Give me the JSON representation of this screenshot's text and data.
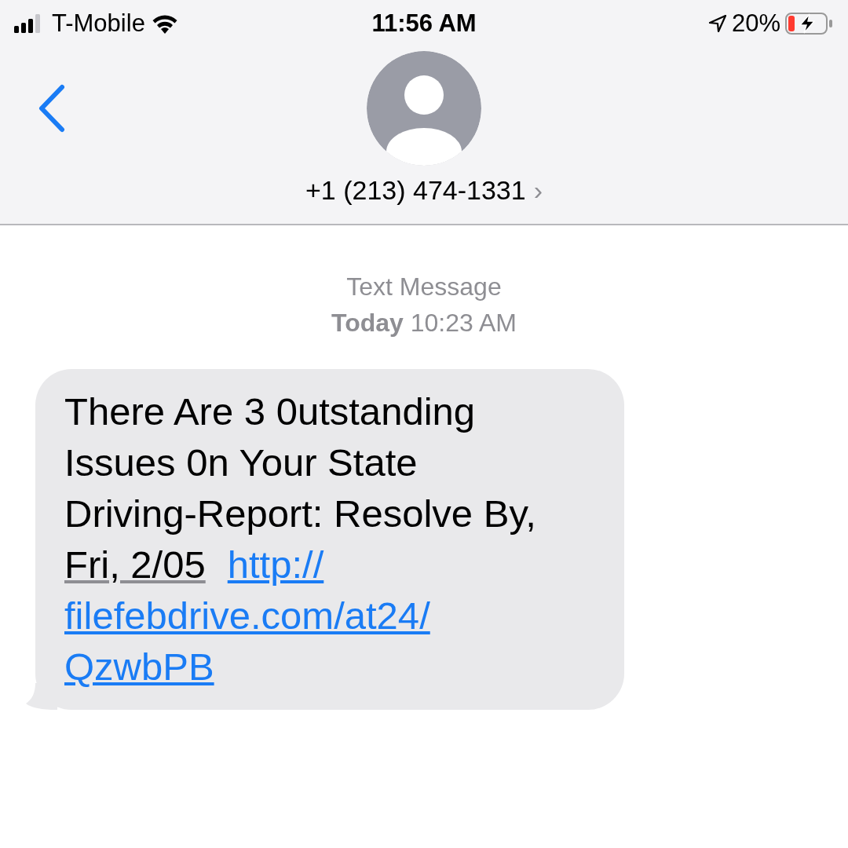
{
  "status_bar": {
    "carrier": "T-Mobile",
    "time": "11:56 AM",
    "battery_percent": "20%",
    "charging": true
  },
  "header": {
    "contact": "+1 (213) 474-1331",
    "chevron": "›"
  },
  "thread": {
    "service": "Text Message",
    "day": "Today",
    "time": "10:23 AM"
  },
  "messages": [
    {
      "incoming": true,
      "lines": [
        [
          {
            "kind": "text",
            "text": "There Are 3 0utstanding"
          }
        ],
        [
          {
            "kind": "text",
            "text": "Issues 0n Your State"
          }
        ],
        [
          {
            "kind": "text",
            "text": "Driving-Report: Resolve By,"
          }
        ],
        [
          {
            "kind": "date",
            "text": "Fri, 2/05"
          },
          {
            "kind": "link",
            "text": "http://"
          }
        ],
        [
          {
            "kind": "link",
            "text": "filefebdrive.com/at24/"
          }
        ],
        [
          {
            "kind": "link",
            "text": "QzwbPB"
          }
        ]
      ]
    }
  ]
}
